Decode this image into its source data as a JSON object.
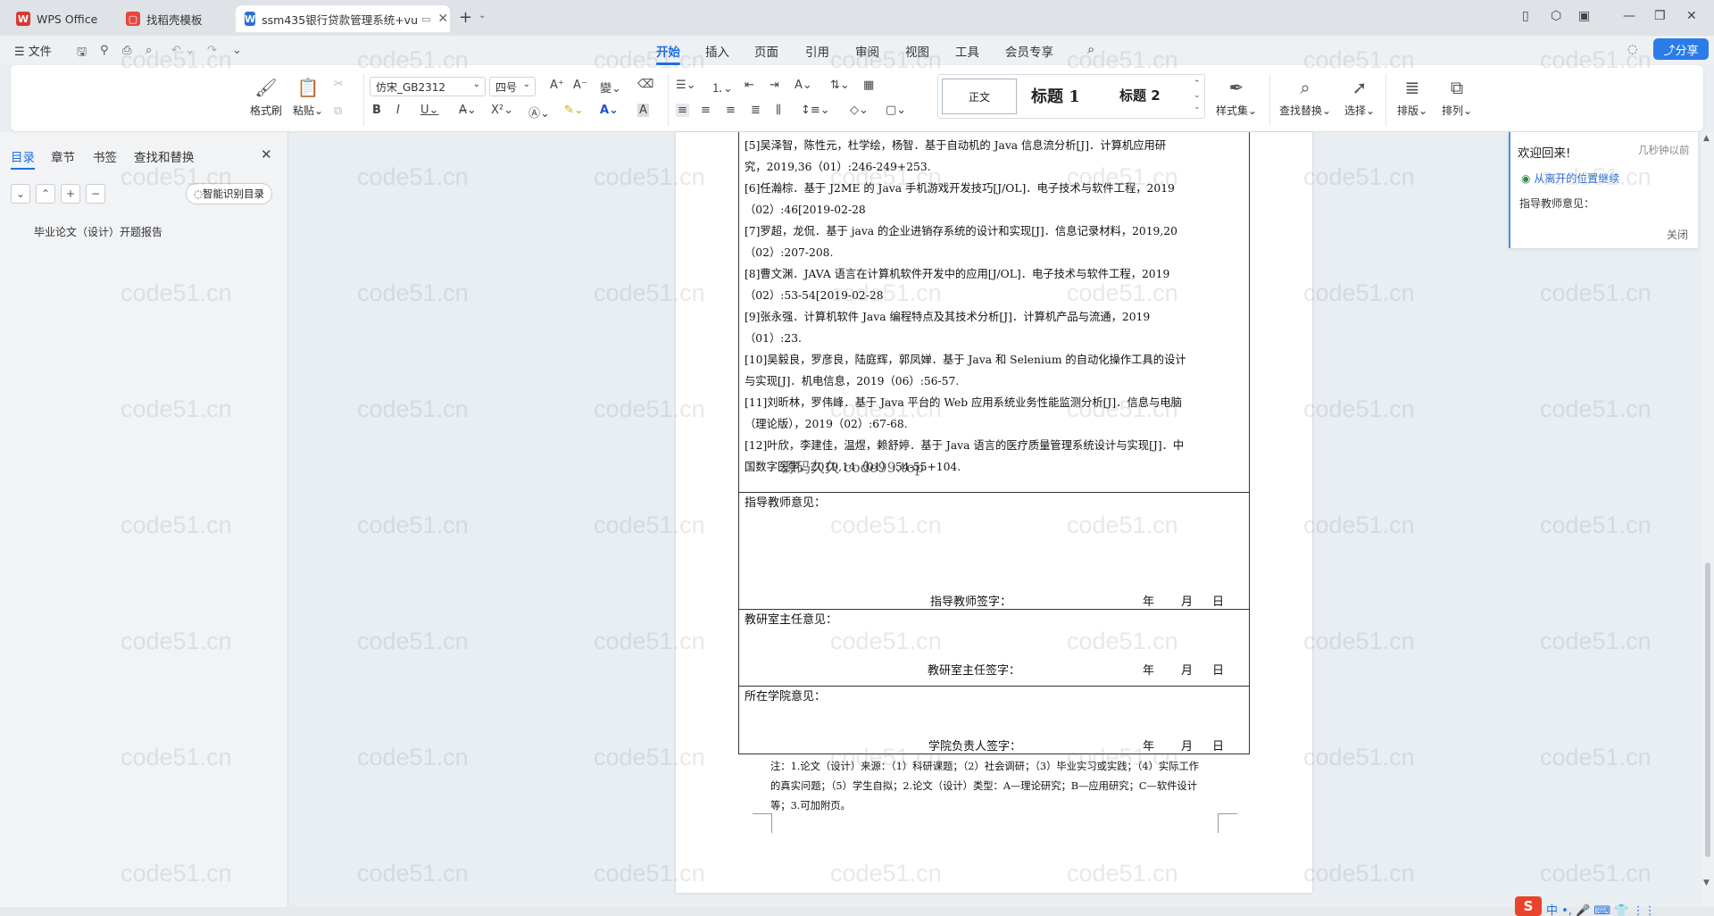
{
  "tabs": [
    {
      "label": "WPS Office",
      "icon": "wps-logo"
    },
    {
      "label": "找稻壳模板",
      "icon": "daoke-icon"
    },
    {
      "label": "ssm435银行贷款管理系统+vu",
      "icon": "word-doc-icon"
    }
  ],
  "menu": {
    "file": "文件",
    "tabs": [
      "开始",
      "插入",
      "页面",
      "引用",
      "审阅",
      "视图",
      "工具",
      "会员专享"
    ],
    "share": "分享"
  },
  "ribbon": {
    "format_painter": "格式刷",
    "paste": "粘贴",
    "font_name": "仿宋_GB2312",
    "font_size": "四号",
    "styles": [
      "正文",
      "标题 1",
      "标题 2"
    ],
    "style_set": "样式集",
    "find_replace": "查找替换",
    "select": "选择",
    "layout": "排版",
    "arrange": "排列"
  },
  "panel": {
    "tabs": [
      "目录",
      "章节",
      "书签",
      "查找和替换"
    ],
    "smart_toc": "智能识别目录",
    "toc_item": "毕业论文（设计）开题报告"
  },
  "references": [
    "[5]吴泽智，陈性元，杜学绘，杨智．基于自动机的 Java 信息流分析[J]．计算机应用研",
    "究，2019,36（01）:246-249+253.",
    "[6]任瀚棕．基于 J2ME 的 Java 手机游戏开发技巧[J/OL]．电子技术与软件工程，2019",
    "（02）:46[2019-02-28",
    "[7]罗超，龙侃．基于 java 的企业进销存系统的设计和实现[J]．信息记录材料，2019,20",
    "（02）:207-208.",
    "[8]曹文渊．JAVA 语言在计算机软件开发中的应用[J/OL]．电子技术与软件工程，2019",
    "（02）:53-54[2019-02-28",
    "[9]张永强．计算机软件 Java 编程特点及其技术分析[J]．计算机产品与流通，2019",
    "（01）:23.",
    "[10]吴毅良，罗彦良，陆庭辉，郭凤婵．基于 Java 和 Selenium 的自动化操作工具的设计",
    "与实现[J]．机电信息，2019（06）:56-57.",
    "[11]刘昕林，罗伟峰．基于 Java 平台的 Web 应用系统业务性能监测分析[J]．信息与电脑",
    "（理论版），2019（02）:67-68.",
    "[12]叶欣，李建佳，温煜，赖舒婷．基于 Java 语言的医疗质量管理系统设计与实现[J]．中",
    "国数字医学，2019,14（01）:54-55+104."
  ],
  "overlay_text": "源码久久 code99.top",
  "form": {
    "advisor_opinion": "指导教师意见：",
    "advisor_sign": "指导教师签字：",
    "director_opinion": "教研室主任意见：",
    "director_sign": "教研室主任签字：",
    "college_opinion": "所在学院意见：",
    "college_sign": "学院负责人签字：",
    "year": "年",
    "month": "月",
    "day": "日"
  },
  "note": [
    "注：1.论文（设计）来源：（1）科研课题；（2）社会调研；（3）毕业实习或实践；（4）实际工作",
    "的真实问题；（5）学生自拟；2.论文（设计）类型：A—理论研究；B—应用研究；C—软件设计",
    "等；3.可加附页。"
  ],
  "welcome": {
    "title": "欢迎回来!",
    "time": "几秒钟以前",
    "resume": "从离开的位置继续",
    "context": "指导教师意见：",
    "close": "关闭"
  },
  "watermark": "code51.cn"
}
